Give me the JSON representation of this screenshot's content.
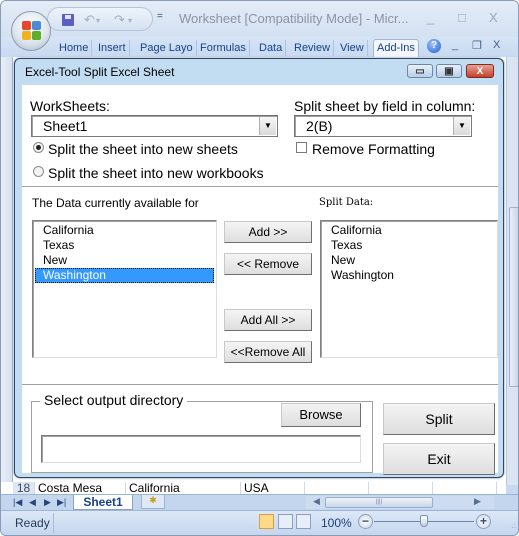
{
  "excel": {
    "window_title": "Worksheet  [Compatibility Mode] - Micr...",
    "quick_access": {
      "save": "save-icon",
      "undo": "↶",
      "redo": "↷",
      "customize": "="
    },
    "window_controls": {
      "minimize": "_",
      "maximize": "□",
      "close": "X"
    },
    "ribbon_tabs": [
      {
        "label": "Home"
      },
      {
        "label": "Insert"
      },
      {
        "label": "Page Layo"
      },
      {
        "label": "Formulas"
      },
      {
        "label": "Data"
      },
      {
        "label": "Review"
      },
      {
        "label": "View"
      },
      {
        "label": "Add-Ins",
        "active": true
      }
    ],
    "ribbon_controls": {
      "help": "?",
      "minimize": "_",
      "restore": "❐",
      "close": "X"
    },
    "visible_row": {
      "number": "18",
      "cells": [
        "Costa Mesa",
        "California",
        "USA"
      ]
    },
    "sheet_tabs": {
      "nav": [
        "◀◀",
        "◀",
        "▶",
        "▶▶"
      ],
      "active": "Sheet1",
      "insert_tab_icon": "new-sheet-icon"
    },
    "statusbar": {
      "status": "Ready",
      "zoom": "100%",
      "zoom_minus": "−",
      "zoom_plus": "+",
      "zoom_fraction": 0.5
    }
  },
  "dialog": {
    "title": "Excel-Tool Split Excel Sheet",
    "controls": {
      "minimize": "▭",
      "maximize": "▣",
      "close": "X"
    },
    "worksheets_label": "WorkSheets:",
    "worksheets_value": "Sheet1",
    "split_field_label": "Split sheet by field in column:",
    "split_field_value": "2(B)",
    "options": [
      {
        "label": "Split the sheet into new sheets",
        "checked": true
      },
      {
        "label": "Split the sheet into new workbooks",
        "checked": false
      }
    ],
    "remove_formatting": {
      "label": "Remove Formatting",
      "checked": false
    },
    "available_label": "The Data currently available for",
    "available_items": [
      "California",
      "Texas",
      "New",
      "Washington"
    ],
    "available_selected": "Washington",
    "split_data_label": "Split Data:",
    "split_items": [
      "California",
      "Texas",
      "New",
      "Washington"
    ],
    "buttons": {
      "add": "Add >>",
      "remove": "<< Remove",
      "add_all": "Add All >>",
      "remove_all": "<<Remove All",
      "browse": "Browse",
      "split": "Split",
      "exit": "Exit"
    },
    "output_dir_label": "Select output directory",
    "output_dir_value": ""
  }
}
